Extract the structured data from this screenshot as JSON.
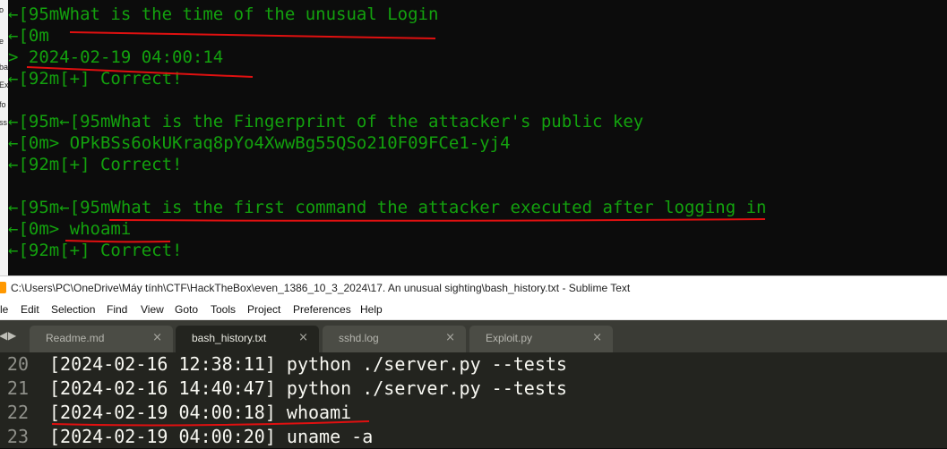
{
  "background_window": {
    "fragments": [
      "o",
      "e",
      "ba",
      "Ex",
      "fo",
      "ss"
    ]
  },
  "terminal": {
    "lines": [
      "←[95mWhat is the time of the unusual Login",
      "←[0m",
      "> 2024-02-19 04:00:14",
      "←[92m[+] Correct!",
      "",
      "←[95m←[95mWhat is the Fingerprint of the attacker's public key",
      "←[0m> OPkBSs6okUKraq8pYo4XwwBg55QSo210F09FCe1-yj4",
      "←[92m[+] Correct!",
      "",
      "←[95m←[95mWhat is the first command the attacker executed after logging in",
      "←[0m> whoami",
      "←[92m[+] Correct!"
    ],
    "text_color": "#13a10e",
    "annotation_color": "#e01010"
  },
  "sublime": {
    "title": "C:\\Users\\PC\\OneDrive\\Máy tính\\CTF\\HackTheBox\\even_1386_10_3_2024\\17. An unusual sighting\\bash_history.txt - Sublime Text",
    "menu": [
      "le",
      "Edit",
      "Selection",
      "Find",
      "View",
      "Goto",
      "Tools",
      "Project",
      "Preferences",
      "Help"
    ],
    "tabs": [
      {
        "label": "Readme.md",
        "active": false
      },
      {
        "label": "bash_history.txt",
        "active": true
      },
      {
        "label": "sshd.log",
        "active": false
      },
      {
        "label": "Exploit.py",
        "active": false
      }
    ],
    "tab_close_glyph": "×",
    "lines": [
      {
        "num": "20",
        "text": "[2024-02-16 12:38:11] python ./server.py --tests"
      },
      {
        "num": "21",
        "text": "[2024-02-16 14:40:47] python ./server.py --tests"
      },
      {
        "num": "22",
        "text": "[2024-02-19 04:00:18] whoami"
      },
      {
        "num": "23",
        "text": "[2024-02-19 04:00:20] uname -a"
      }
    ]
  }
}
